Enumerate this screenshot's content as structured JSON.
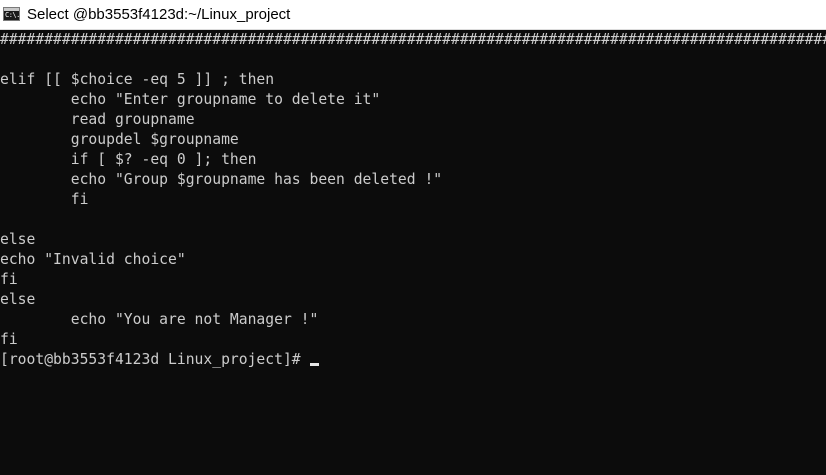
{
  "window": {
    "title": "Select @bb3553f4123d:~/Linux_project",
    "icon": "cmd-console-icon",
    "icon_glyph": "C:\\."
  },
  "terminal": {
    "colors": {
      "background": "#0c0c0c",
      "foreground": "#cccccc"
    },
    "lines": [
      "################################################################################################",
      "",
      "elif [[ $choice -eq 5 ]] ; then",
      "        echo \"Enter groupname to delete it\"",
      "        read groupname",
      "        groupdel $groupname",
      "        if [ $? -eq 0 ]; then",
      "        echo \"Group $groupname has been deleted !\"",
      "        fi",
      "",
      "else",
      "echo \"Invalid choice\"",
      "fi",
      "else",
      "        echo \"You are not Manager !\"",
      "fi"
    ],
    "prompt": "[root@bb3553f4123d Linux_project]#"
  }
}
